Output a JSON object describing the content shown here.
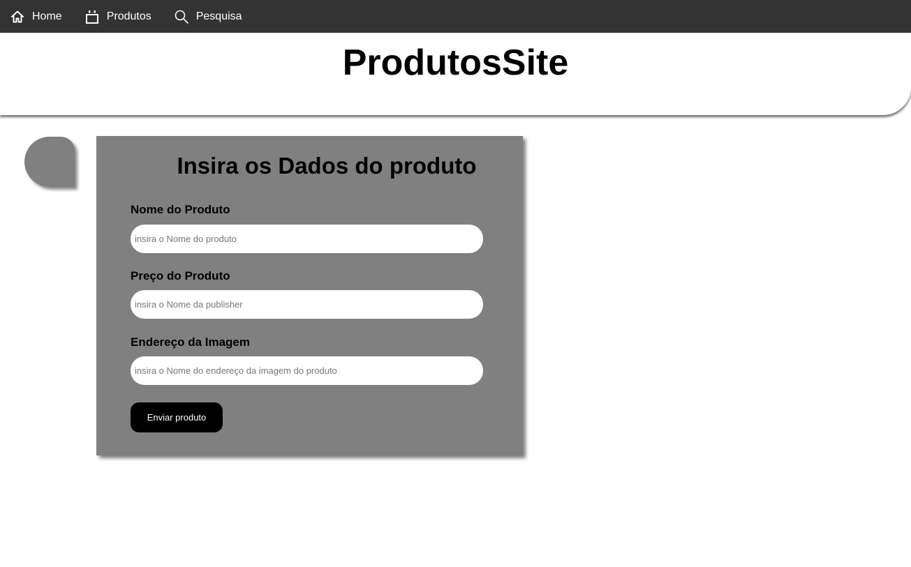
{
  "nav": {
    "items": [
      {
        "label": "Home",
        "icon": "home-icon"
      },
      {
        "label": "Produtos",
        "icon": "shopping-bag-icon"
      },
      {
        "label": "Pesquisa",
        "icon": "search-icon"
      }
    ]
  },
  "header": {
    "title": "ProdutosSite"
  },
  "form": {
    "title": "Insira os Dados do produto",
    "fields": [
      {
        "label": "Nome do Produto",
        "placeholder": "insira o Nome do produto",
        "value": ""
      },
      {
        "label": "Preço do Produto",
        "placeholder": "insira o Nome da publisher",
        "value": ""
      },
      {
        "label": "Endereço da Imagem",
        "placeholder": "insira o Nome do endereço da imagem do produto",
        "value": ""
      }
    ],
    "submit_label": "Enviar produto"
  },
  "colors": {
    "nav_bg": "#333333",
    "card_bg": "#808080",
    "button_bg": "#000000"
  }
}
